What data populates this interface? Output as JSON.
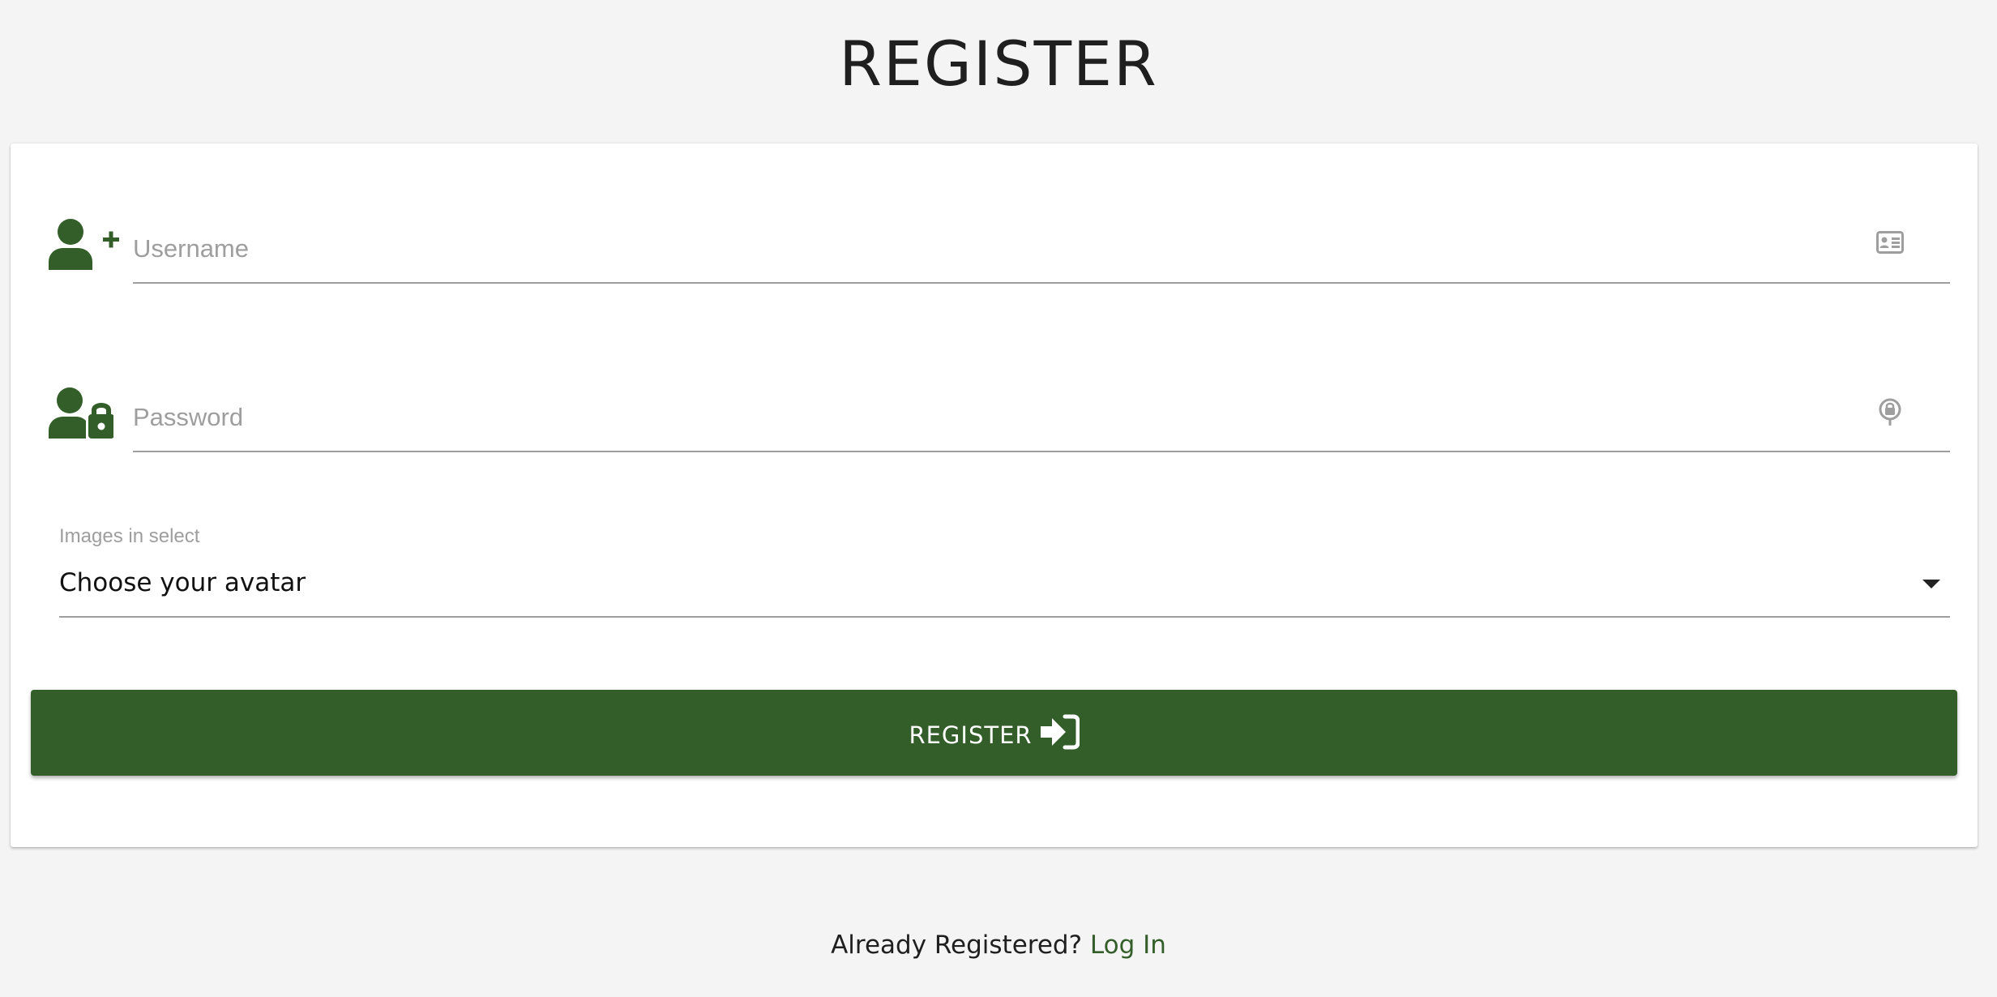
{
  "page": {
    "title": "REGISTER"
  },
  "form": {
    "username": {
      "placeholder": "Username",
      "value": "",
      "prefix_icon": "user-plus-icon",
      "suffix_icon": "id-card-icon"
    },
    "password": {
      "placeholder": "Password",
      "value": "",
      "prefix_icon": "user-lock-icon",
      "suffix_icon": "fingerprint-lock-icon"
    },
    "avatar_select": {
      "label": "Images in select",
      "selected": "Choose your avatar"
    },
    "submit": {
      "label": "REGISTER",
      "icon": "sign-in-icon"
    }
  },
  "footer": {
    "prompt": "Already Registered?",
    "link_label": "Log In"
  },
  "colors": {
    "accent": "#335e29",
    "background": "#f4f4f4",
    "muted": "#9e9e9e"
  }
}
